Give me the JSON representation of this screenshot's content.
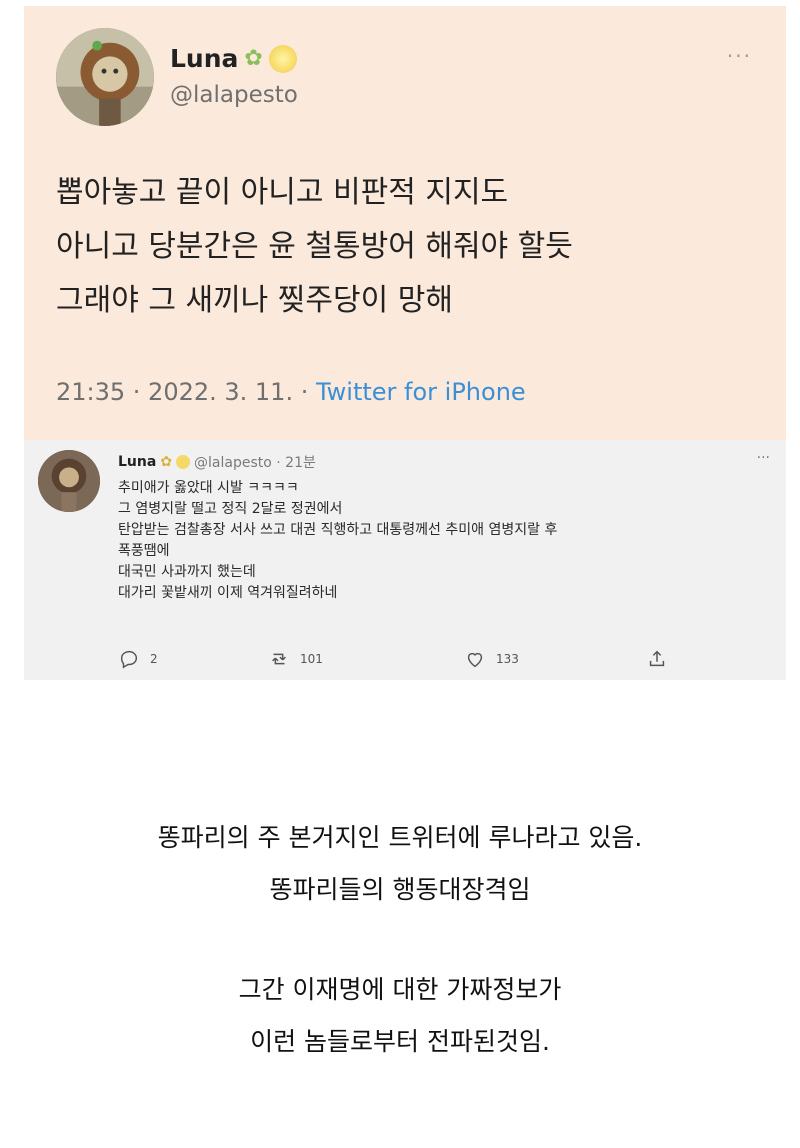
{
  "tweet1": {
    "display_name": "Luna",
    "name_emoji_1": "✿",
    "handle": "@lalapesto",
    "more": "···",
    "lines": [
      "뽑아놓고 끝이 아니고 비판적 지지도",
      "아니고 당분간은 윤 철통방어 해줘야 할듯",
      "그래야 그 새끼나 찢주당이 망해"
    ],
    "time": "21:35 · 2022. 3. 11. · ",
    "source": "Twitter for iPhone"
  },
  "tweet2": {
    "display_name": "Luna",
    "handle_time": "@lalapesto · 21분",
    "more": "···",
    "lines": [
      "추미애가 옳았대 시발 ㅋㅋㅋㅋ",
      "그 염병지랄 떨고 정직 2달로 정권에서",
      "탄압받는 검찰총장 서사 쓰고 대권 직행하고 대통령께선 추미애 염병지랄 후",
      "폭풍땜에",
      "대국민 사과까지 했는데",
      "대가리 꽃밭새끼 이제 역겨워질려하네"
    ],
    "replies": "2",
    "retweets": "101",
    "likes": "133"
  },
  "caption": {
    "lines": [
      "똥파리의 주 본거지인 트위터에 루나라고 있음.",
      "똥파리들의 행동대장격임",
      "그간 이재명에 대한 가짜정보가",
      "이런 놈들로부터 전파된것임."
    ]
  },
  "colors": {
    "card1_bg": "#fbe9dc",
    "card2_bg": "#f1f1f1",
    "link": "#3b8fd6"
  },
  "icons": [
    "reply-icon",
    "retweet-icon",
    "like-icon",
    "share-icon"
  ]
}
